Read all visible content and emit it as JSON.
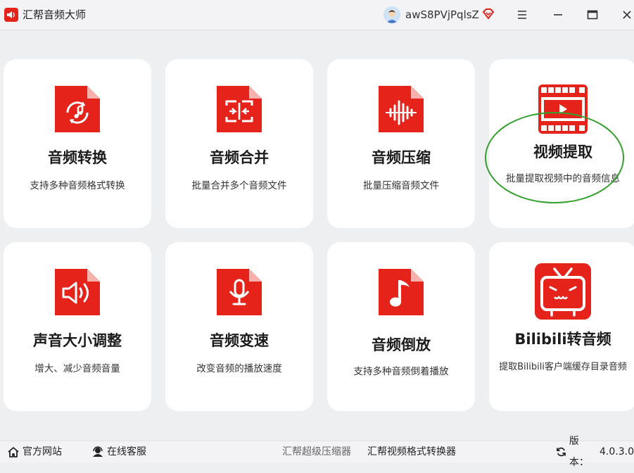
{
  "app": {
    "title": "汇帮音频大师"
  },
  "user": {
    "name": "awS8PVjPqlsZ"
  },
  "colors": {
    "accent": "#e5231b",
    "highlight_ring": "#33a02c"
  },
  "cards": [
    {
      "title": "音频转换",
      "desc": "支持多种音频格式转换",
      "icon": "audio-convert-icon"
    },
    {
      "title": "音频合并",
      "desc": "批量合并多个音频文件",
      "icon": "audio-merge-icon"
    },
    {
      "title": "音频压缩",
      "desc": "批量压缩音频文件",
      "icon": "audio-compress-icon"
    },
    {
      "title": "视频提取",
      "desc": "批量提取视频中的音频信息",
      "icon": "video-extract-icon"
    },
    {
      "title": "声音大小调整",
      "desc": "增大、减少音频音量",
      "icon": "volume-adjust-icon"
    },
    {
      "title": "音频变速",
      "desc": "改变音频的播放速度",
      "icon": "audio-speed-icon"
    },
    {
      "title": "音频倒放",
      "desc": "支持多种音频倒着播放",
      "icon": "audio-reverse-icon"
    },
    {
      "title": "Bilibili转音频",
      "desc": "提取Bilibili客户端缓存目录音频",
      "icon": "bilibili-icon"
    }
  ],
  "footer": {
    "website": "官方网站",
    "support": "在线客服",
    "link1": "汇帮超级压缩器",
    "link2": "汇帮视频格式转换器",
    "version_label": "版本：",
    "version": "4.0.3.0"
  }
}
